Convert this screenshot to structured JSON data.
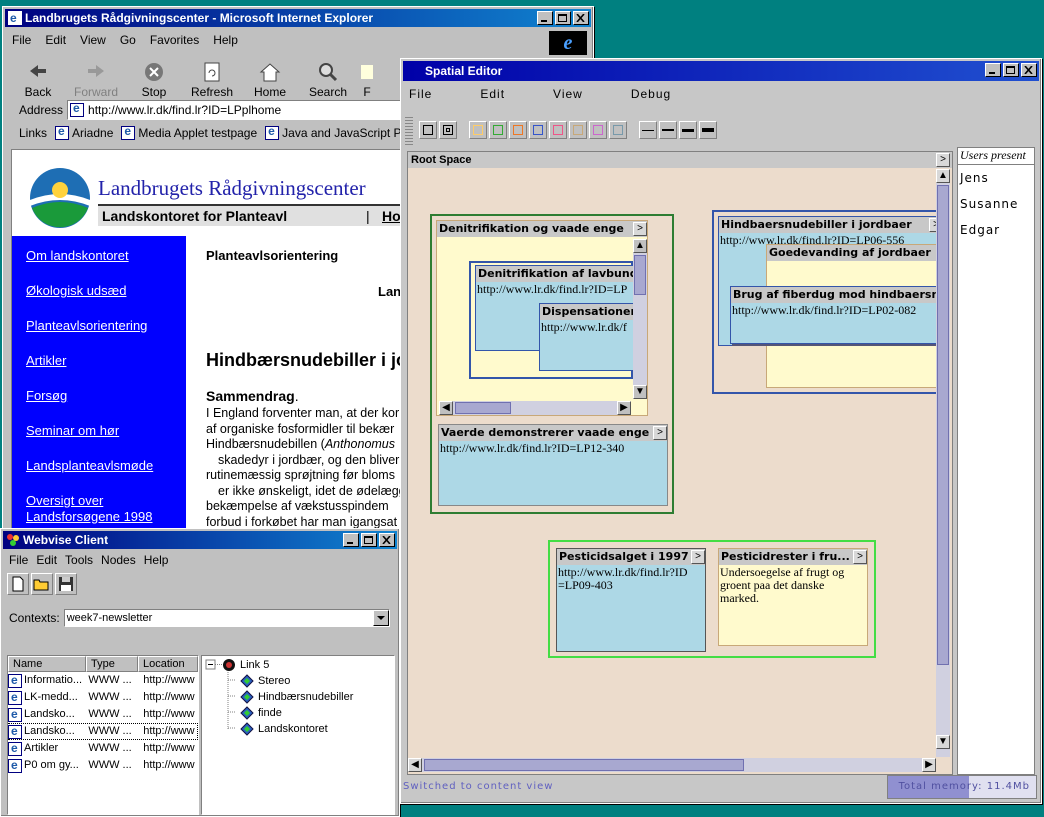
{
  "ie": {
    "title": "Landbrugets Rådgivningscenter - Microsoft Internet Explorer",
    "menu": [
      "File",
      "Edit",
      "View",
      "Go",
      "Favorites",
      "Help"
    ],
    "toolbar": [
      {
        "label": "Back",
        "icon": "back-arrow-icon"
      },
      {
        "label": "Forward",
        "icon": "forward-arrow-icon"
      },
      {
        "label": "Stop",
        "icon": "stop-icon"
      },
      {
        "label": "Refresh",
        "icon": "refresh-icon"
      },
      {
        "label": "Home",
        "icon": "home-icon"
      },
      {
        "label": "Search",
        "icon": "search-icon"
      },
      {
        "label": "F",
        "icon": "favorites-icon"
      }
    ],
    "address_label": "Address",
    "address_value": "http://www.lr.dk/find.lr?ID=LPplhome",
    "links_label": "Links",
    "links": [
      "Ariadne",
      "Media Applet testpage",
      "Java and JavaScript Prog"
    ],
    "page": {
      "site_title": "Landbrugets Rådgivningscenter",
      "subtitle": "Landskontoret for Planteavl",
      "subtitle_link": "Hov",
      "nav": [
        "Om landskontoret",
        "Økologisk udsæd",
        "Planteavlsorientering",
        "Artikler",
        "Forsøg",
        "Seminar om hør",
        "Landsplanteavlsmøde",
        "Oversigt over Landsforsøgene 1998"
      ],
      "section": "Planteavlsorientering",
      "fragment": "Lan",
      "headline": "Hindbærsnudebiller i jo",
      "summary_label": "Sammendrag",
      "summary_dot": ".",
      "body_lines": [
        "I England forventer man, at der kor",
        "af organiske fosformidler til bekær",
        "Hindbærsnudebillen (",
        "skadedyr i jordbær, og den bliver f",
        "rutinemæssig sprøjtning før bloms",
        "er ikke ønskeligt, idet de ødelægg",
        "bekæmpelse af vækstusspindem",
        "forbud i forkøbet har man igangsat"
      ],
      "italic_word": "Anthonomus"
    },
    "colors": {
      "nav_bg": "#0000ff",
      "nav_link": "#ffffff",
      "site_title": "#2222aa"
    }
  },
  "se": {
    "title": "Spatial Editor",
    "menu": [
      "File",
      "Edit",
      "View",
      "Debug"
    ],
    "swatch_colors": [
      "#ffcc66",
      "#33aa33",
      "#ee7722",
      "#3355cc",
      "#ee5588",
      "#c8a878",
      "#cc66cc",
      "#7799aa"
    ],
    "root_label": "Root Space",
    "spaces": [
      {
        "title": "Denitrifikation og vaade enge"
      },
      {
        "title": "Hindbaersnudebiller i jordbaer",
        "url": "http://www.lr.dk/find.lr?ID=LP06-556"
      }
    ],
    "nodes": {
      "n1": {
        "title": "Denitrifikation af lavbundsjord",
        "body": "http://www.lr.dk/find.lr?ID=LP"
      },
      "n2": {
        "title": "Dispensationer",
        "body": "http://www.lr.dk/f"
      },
      "n3": {
        "title": "Vaerde demonstrerer vaade enge",
        "body": "http://www.lr.dk/find.lr?ID=LP12-340"
      },
      "n4": {
        "title": "Goedevanding af jordbaer"
      },
      "n5": {
        "title": "Brug af fiberdug mod hindbaersnudebiller",
        "body": "http://www.lr.dk/find.lr?ID=LP02-082"
      },
      "n6": {
        "title": "Pesticidsalget i 1997",
        "body1": "http://www.lr.dk/find.lr?ID",
        "body2": "=LP09-403"
      },
      "n7": {
        "title": "Pesticidrester i fru...",
        "body1": "Undersoegelse af frugt og",
        "body2": "groent paa det danske",
        "body3": "marked."
      }
    },
    "users_header": "Users present",
    "users": [
      "Jens",
      "Susanne",
      "Edgar"
    ],
    "status": "Switched to content view",
    "memory_label": "Total memory:",
    "memory_value": "11.4Mb",
    "memory_fill": 0.55
  },
  "wv": {
    "title": "Webvise Client",
    "menu": [
      "File",
      "Edit",
      "Tools",
      "Nodes",
      "Help"
    ],
    "contexts_label": "Contexts:",
    "contexts_value": "week7-newsletter",
    "columns": [
      "Name",
      "Type",
      "Location"
    ],
    "rows": [
      {
        "name": "Informatio...",
        "type": "WWW ...",
        "loc": "http://www"
      },
      {
        "name": "LK-medd...",
        "type": "WWW ...",
        "loc": "http://www"
      },
      {
        "name": "Landsko...",
        "type": "WWW ...",
        "loc": "http://www"
      },
      {
        "name": "Landsko...",
        "type": "WWW ...",
        "loc": "http://www"
      },
      {
        "name": "Artikler",
        "type": "WWW ...",
        "loc": "http://www"
      },
      {
        "name": "P0 om gy...",
        "type": "WWW ...",
        "loc": "http://www"
      }
    ],
    "tree_root": "Link 5",
    "tree_children": [
      "Stereo",
      "Hindbærsnudebiller",
      "finde",
      "Landskontoret"
    ]
  }
}
